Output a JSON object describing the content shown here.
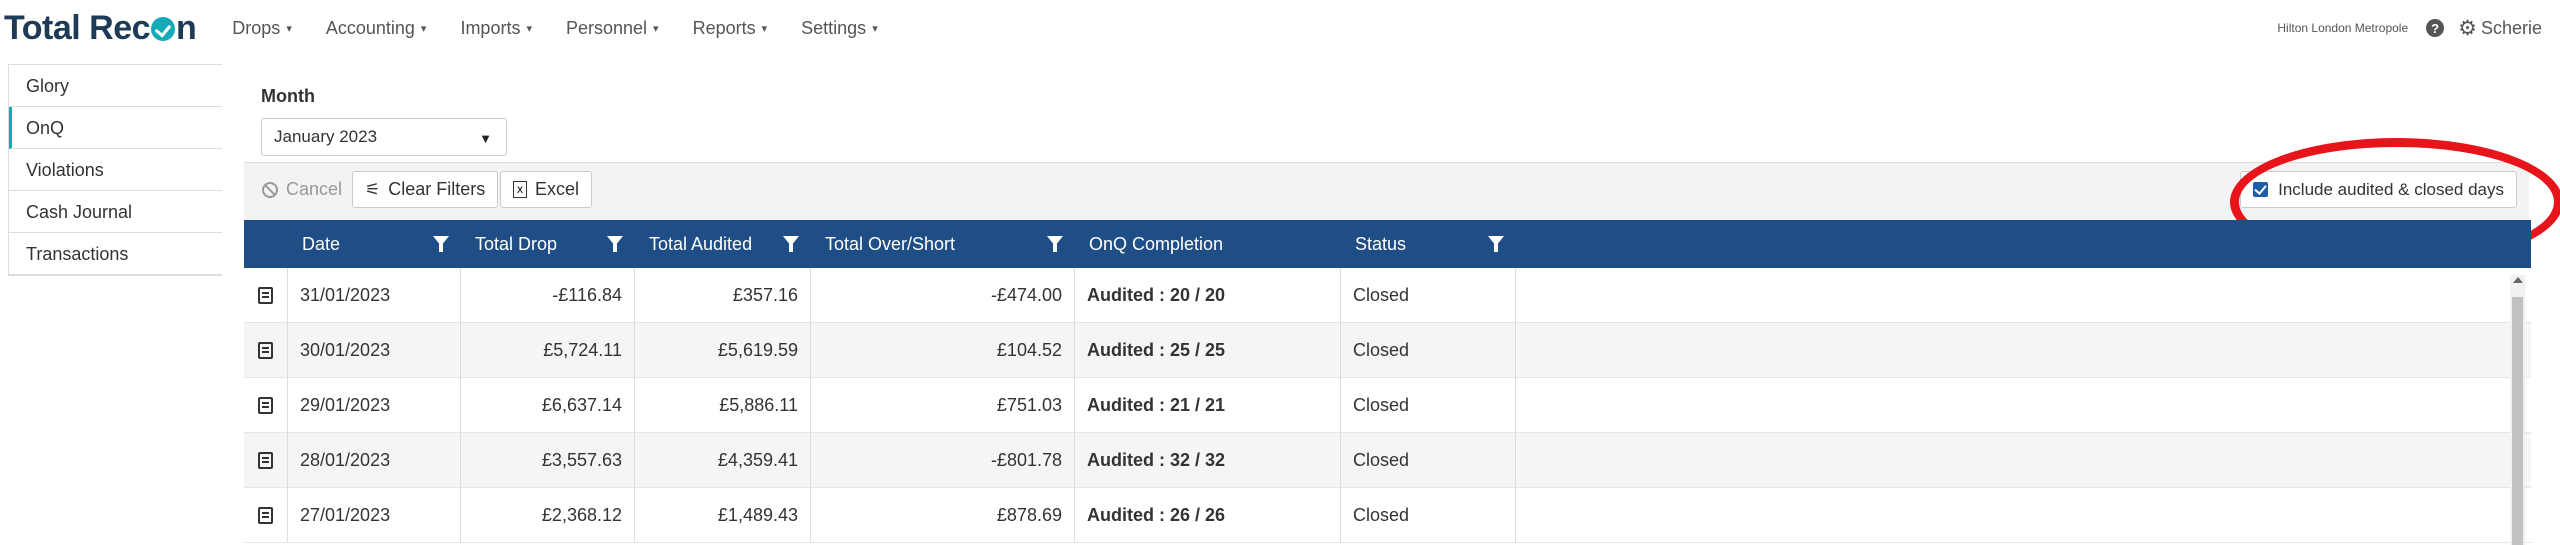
{
  "brand": {
    "text_before": "Total Rec",
    "text_after": "n"
  },
  "nav": {
    "items": [
      {
        "label": "Drops"
      },
      {
        "label": "Accounting"
      },
      {
        "label": "Imports"
      },
      {
        "label": "Personnel"
      },
      {
        "label": "Reports"
      },
      {
        "label": "Settings"
      }
    ],
    "caret": "▾",
    "hotel": "Hilton London Metropole",
    "help_glyph": "?",
    "user": "Scherie"
  },
  "sidebar": {
    "items": [
      {
        "label": "Glory"
      },
      {
        "label": "OnQ",
        "active": true
      },
      {
        "label": "Violations"
      },
      {
        "label": "Cash Journal"
      },
      {
        "label": "Transactions"
      }
    ]
  },
  "filters": {
    "month_label": "Month",
    "month_value": "January 2023",
    "caret": "▼"
  },
  "toolbar": {
    "cancel": "Cancel",
    "clear_filters": "Clear Filters",
    "excel": "Excel",
    "include_audited": "Include audited & closed days",
    "include_checked": true
  },
  "grid": {
    "columns": [
      "Date",
      "Total Drop",
      "Total Audited",
      "Total Over/Short",
      "OnQ Completion",
      "Status"
    ],
    "rows": [
      {
        "date": "31/01/2023",
        "total_drop": "-£116.84",
        "total_audited": "£357.16",
        "over_short": "-£474.00",
        "completion": "Audited : 20 / 20",
        "status": "Closed"
      },
      {
        "date": "30/01/2023",
        "total_drop": "£5,724.11",
        "total_audited": "£5,619.59",
        "over_short": "£104.52",
        "completion": "Audited : 25 / 25",
        "status": "Closed"
      },
      {
        "date": "29/01/2023",
        "total_drop": "£6,637.14",
        "total_audited": "£5,886.11",
        "over_short": "£751.03",
        "completion": "Audited : 21 / 21",
        "status": "Closed"
      },
      {
        "date": "28/01/2023",
        "total_drop": "£3,557.63",
        "total_audited": "£4,359.41",
        "over_short": "-£801.78",
        "completion": "Audited : 32 / 32",
        "status": "Closed"
      },
      {
        "date": "27/01/2023",
        "total_drop": "£2,368.12",
        "total_audited": "£1,489.43",
        "over_short": "£878.69",
        "completion": "Audited : 26 / 26",
        "status": "Closed"
      }
    ]
  },
  "colors": {
    "brand": "#1d3a57",
    "accent": "#15aab8",
    "grid_header": "#1f4e86",
    "highlight": "#e8141b",
    "checkbox": "#1d5fa6"
  }
}
